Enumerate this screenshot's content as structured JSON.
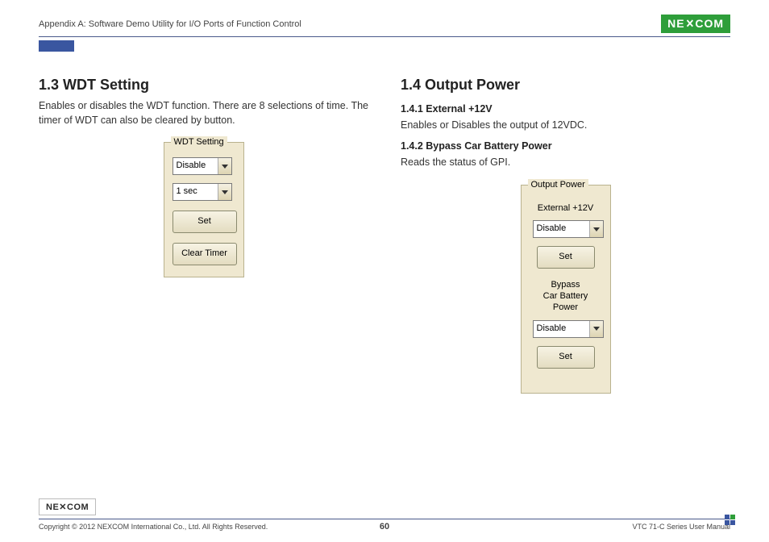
{
  "header": {
    "appendix_title": "Appendix A: Software Demo Utility for I/O Ports of Function Control",
    "logo_text": "NE COM"
  },
  "left": {
    "heading": "1.3  WDT Setting",
    "paragraph": "Enables or disables the WDT function. There are 8 selections of time. The timer of WDT can also be cleared by button.",
    "dialog": {
      "legend": "WDT Setting",
      "combo_enable": "Disable",
      "combo_time": "1 sec",
      "btn_set": "Set",
      "btn_clear": "Clear Timer"
    }
  },
  "right": {
    "heading": "1.4  Output Power",
    "sub1_heading": "1.4.1  External +12V",
    "sub1_text": "Enables or Disables the output of 12VDC.",
    "sub2_heading": "1.4.2  Bypass Car Battery Power",
    "sub2_text": "Reads the status of GPI.",
    "dialog": {
      "legend": "Output Power",
      "label_ext": "External +12V",
      "combo_ext": "Disable",
      "btn_ext_set": "Set",
      "label_bypass_l1": "Bypass",
      "label_bypass_l2": "Car Battery",
      "label_bypass_l3": "Power",
      "combo_bypass": "Disable",
      "btn_bypass_set": "Set"
    }
  },
  "footer": {
    "logo_text": "NE COM",
    "copyright": "Copyright © 2012 NEXCOM International Co., Ltd. All Rights Reserved.",
    "page_number": "60",
    "manual": "VTC 71-C Series User Manual"
  }
}
